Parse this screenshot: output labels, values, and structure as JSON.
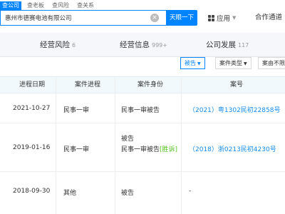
{
  "search": {
    "tabs": [
      "查公司",
      "查老板",
      "查风险",
      "查关系"
    ],
    "query": "惠州市德赛电池有限公司",
    "button_label": "天眼一下"
  },
  "header": {
    "apps_label": "应用",
    "partner_label": "合作通道"
  },
  "section_tabs": [
    {
      "label": "经营风险",
      "count": "6"
    },
    {
      "label": "经营信息",
      "count": "999+"
    },
    {
      "label": "公司发展",
      "count": "117"
    }
  ],
  "filters": [
    {
      "label": "被告"
    },
    {
      "label": "案件类型"
    },
    {
      "label": "案由不限"
    }
  ],
  "table": {
    "headers": [
      "进程日期",
      "案件进程",
      "案件身份",
      "案号"
    ],
    "rows": [
      {
        "date": "2021-10-27",
        "stage": "民事一审",
        "identity_1": "民事一审被告",
        "identity_2": "",
        "win": "",
        "case_no": "（2021）粤1302民初22858号"
      },
      {
        "date": "2019-01-16",
        "stage": "民事一审",
        "identity_1": "被告",
        "identity_2": "民事一审被告",
        "win": "[胜诉]",
        "case_no": "（2018）浙0213民初4230号"
      },
      {
        "date": "2018-09-30",
        "stage": "其他",
        "identity_1": "被告",
        "identity_2": "",
        "win": "",
        "case_no": "-"
      }
    ]
  },
  "colors": {
    "accent": "#0084ff",
    "link": "#128bed",
    "win": "#52c41a"
  }
}
